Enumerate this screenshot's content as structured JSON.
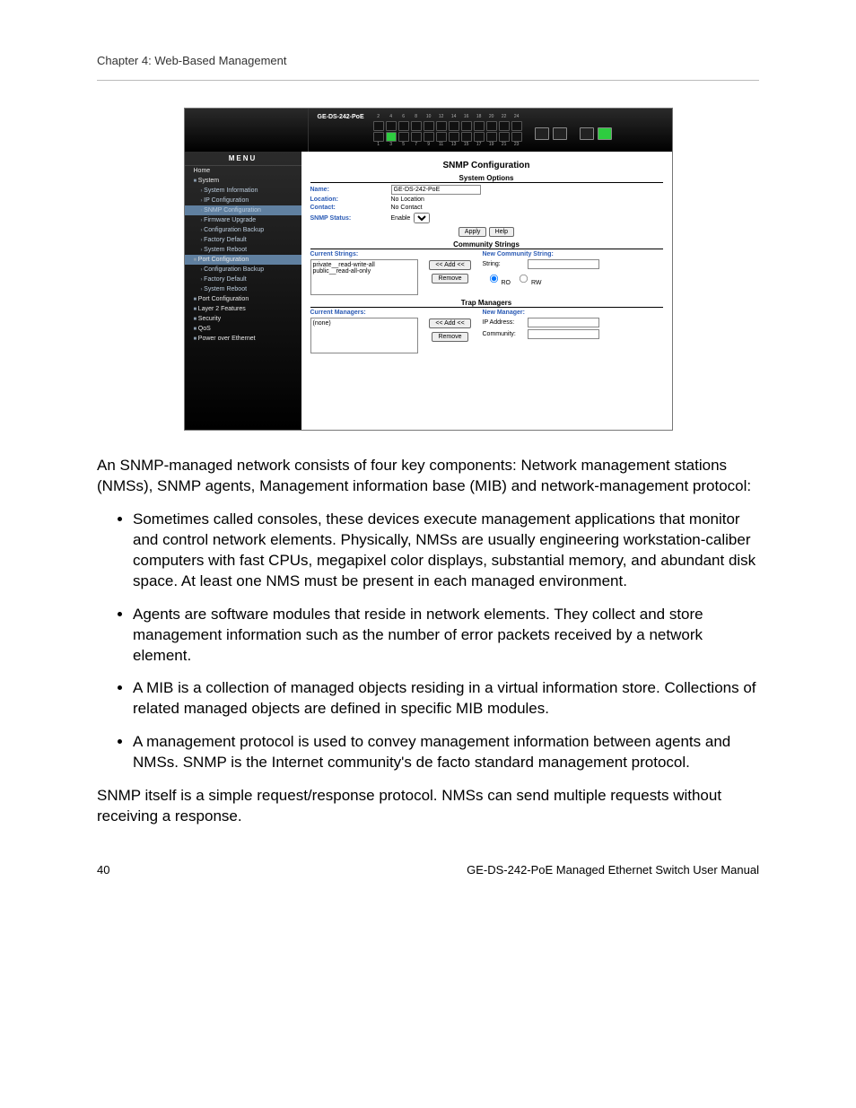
{
  "chapter_header": "Chapter 4: Web-Based Management",
  "footer": {
    "page": "40",
    "manual": "GE-DS-242-PoE Managed Ethernet Switch User Manual"
  },
  "screenshot": {
    "device_name": "GE-DS-242-PoE",
    "port_nums_top": [
      "2",
      "4",
      "6",
      "8",
      "10",
      "12",
      "14",
      "16",
      "18",
      "20",
      "22",
      "24"
    ],
    "port_nums_bot": [
      "1",
      "3",
      "5",
      "7",
      "9",
      "11",
      "13",
      "15",
      "17",
      "19",
      "21",
      "23"
    ],
    "menu": {
      "title": "MENU",
      "items": [
        {
          "label": "Home",
          "cls": "menu-item"
        },
        {
          "label": "System",
          "cls": "menu-item top"
        },
        {
          "label": "System Information",
          "cls": "menu-item sub"
        },
        {
          "label": "IP Configuration",
          "cls": "menu-item sub"
        },
        {
          "label": "SNMP Configuration",
          "cls": "menu-item sub sel"
        },
        {
          "label": "Firmware Upgrade",
          "cls": "menu-item sub"
        },
        {
          "label": "Configuration Backup",
          "cls": "menu-item sub"
        },
        {
          "label": "Factory Default",
          "cls": "menu-item sub"
        },
        {
          "label": "System Reboot",
          "cls": "menu-item sub"
        },
        {
          "label": "Port Configuration",
          "cls": "menu-item top sel"
        },
        {
          "label": "Configuration Backup",
          "cls": "menu-item sub"
        },
        {
          "label": "Factory Default",
          "cls": "menu-item sub"
        },
        {
          "label": "System Reboot",
          "cls": "menu-item sub"
        },
        {
          "label": "Port Configuration",
          "cls": "menu-item top"
        },
        {
          "label": "Layer 2 Features",
          "cls": "menu-item top"
        },
        {
          "label": "Security",
          "cls": "menu-item top"
        },
        {
          "label": "QoS",
          "cls": "menu-item top"
        },
        {
          "label": "Power over Ethernet",
          "cls": "menu-item top"
        }
      ]
    },
    "content": {
      "title": "SNMP Configuration",
      "system_options": {
        "heading": "System Options",
        "name_label": "Name:",
        "name_value": "GE-DS-242-PoE",
        "location_label": "Location:",
        "location_value": "No Location",
        "contact_label": "Contact:",
        "contact_value": "No Contact",
        "status_label": "SNMP Status:",
        "status_text": "Enable",
        "apply": "Apply",
        "help": "Help"
      },
      "community": {
        "heading": "Community Strings",
        "current_label": "Current Strings:",
        "current_list": "private__read-write-all\npublic__read-all-only",
        "add": "<< Add <<",
        "remove": "Remove",
        "new_label": "New Community String:",
        "string_label": "String:",
        "ro": "RO",
        "rw": "RW"
      },
      "traps": {
        "heading": "Trap Managers",
        "current_label": "Current Managers:",
        "current_list": "(none)",
        "add": "<< Add <<",
        "remove": "Remove",
        "new_label": "New Manager:",
        "ip_label": "IP Address:",
        "comm_label": "Community:"
      }
    }
  },
  "text": {
    "intro": "An SNMP-managed network consists of four key components: Network management stations (NMSs), SNMP agents, Management information base (MIB) and network-management protocol:",
    "li1": "Sometimes called consoles, these devices execute management applications that monitor and control network elements. Physically, NMSs are usually engineering workstation-caliber computers with fast CPUs, megapixel color displays, substantial memory, and abundant disk space. At least one NMS must be present in each managed environment.",
    "li2": "Agents are software modules that reside in network elements. They collect and store management information such as the number of error packets received by a network element.",
    "li3": "A MIB is a collection of managed objects residing in a virtual information store. Collections of related managed objects are defined in specific MIB modules.",
    "li4": "A management protocol is used to convey management information between agents and NMSs. SNMP is the Internet community's de facto standard management protocol.",
    "para2": "SNMP itself is a simple request/response protocol. NMSs can send multiple requests without receiving a response."
  }
}
